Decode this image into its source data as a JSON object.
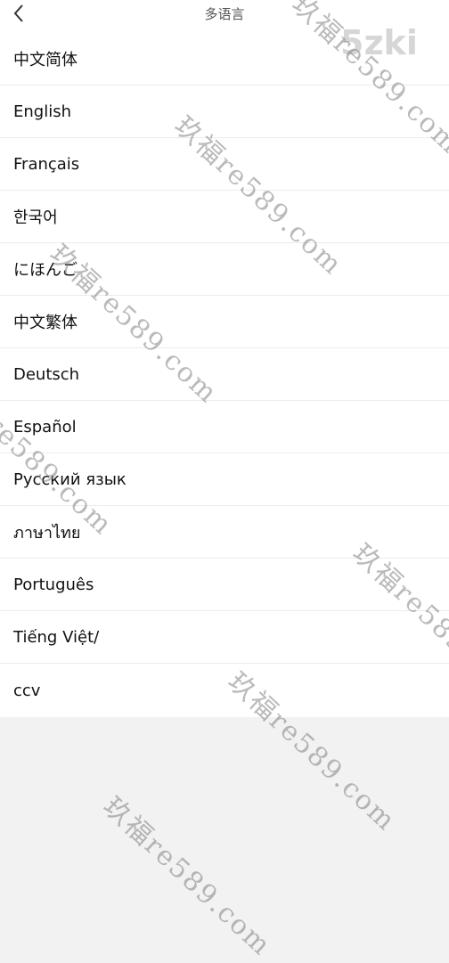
{
  "header": {
    "title": "多语言",
    "back_icon": "chevron-left-icon"
  },
  "languages": [
    {
      "label": "中文简体"
    },
    {
      "label": "English"
    },
    {
      "label": "Français"
    },
    {
      "label": "한국어"
    },
    {
      "label": "にほんご"
    },
    {
      "label": "中文繁体"
    },
    {
      "label": "Deutsch"
    },
    {
      "label": "Español"
    },
    {
      "label": "Русский язык"
    },
    {
      "label": "ภาษาไทย"
    },
    {
      "label": "Português"
    },
    {
      "label": "Tiếng Việt/"
    },
    {
      "label": "ccv"
    }
  ],
  "watermark": {
    "text": "玖福re589.com",
    "logo_text": "5zki"
  }
}
